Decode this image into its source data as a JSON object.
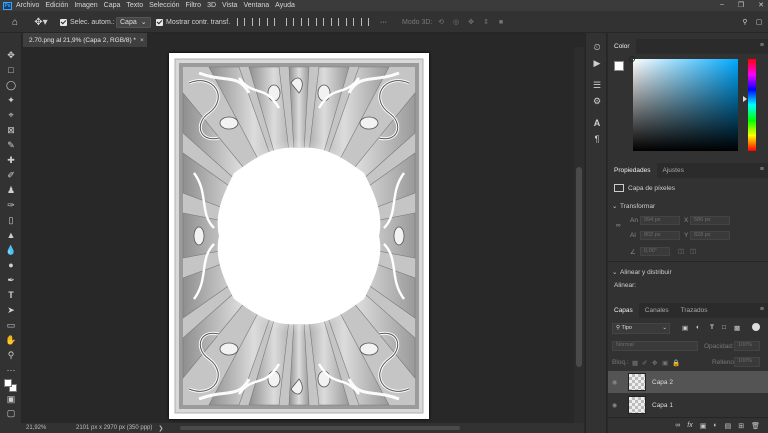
{
  "menubar": {
    "logo": "Ps",
    "items": [
      "Archivo",
      "Edición",
      "Imagen",
      "Capa",
      "Texto",
      "Selección",
      "Filtro",
      "3D",
      "Vista",
      "Ventana",
      "Ayuda"
    ]
  },
  "options": {
    "auto_select_label": "Selec. autom.:",
    "auto_select_value": "Capa",
    "show_transform_label": "Mostrar contr. transf.",
    "mode3d_label": "Modo 3D:"
  },
  "document_tab": {
    "title": "2.70.png al 21,9% (Capa 2, RGB/8) *",
    "close": "×"
  },
  "status": {
    "zoom": "21,92%",
    "doc_info": "2101 px x 2970 px (350 ppp)"
  },
  "color_panel": {
    "tab": "Color"
  },
  "properties": {
    "tabs": [
      "Propiedades",
      "Ajustes"
    ],
    "layer_type": "Capa de píxeles",
    "transform_title": "Transformar",
    "w_label": "An",
    "w_value": "994 px",
    "x_label": "X",
    "x_value": "586 px",
    "h_label": "Al",
    "h_value": "802 px",
    "y_label": "Y",
    "y_value": "828 px",
    "angle_value": "0,00°",
    "align_title": "Alinear y distribuir",
    "align_label": "Alinear:"
  },
  "layers_panel": {
    "tabs": [
      "Capas",
      "Canales",
      "Trazados"
    ],
    "filter": "Tipo",
    "blend_mode": "Normal",
    "opacity_label": "Opacidad:",
    "opacity_value": "100%",
    "lock_label": "Bloq.:",
    "fill_label": "Relleno:",
    "fill_value": "100%",
    "layers": [
      {
        "name": "Capa 2",
        "selected": true
      },
      {
        "name": "Capa 1",
        "selected": false
      }
    ],
    "footer_icons": [
      "link-icon",
      "fx-icon",
      "mask-icon",
      "adjustment-icon",
      "group-icon",
      "new-layer-icon",
      "trash-icon"
    ]
  }
}
